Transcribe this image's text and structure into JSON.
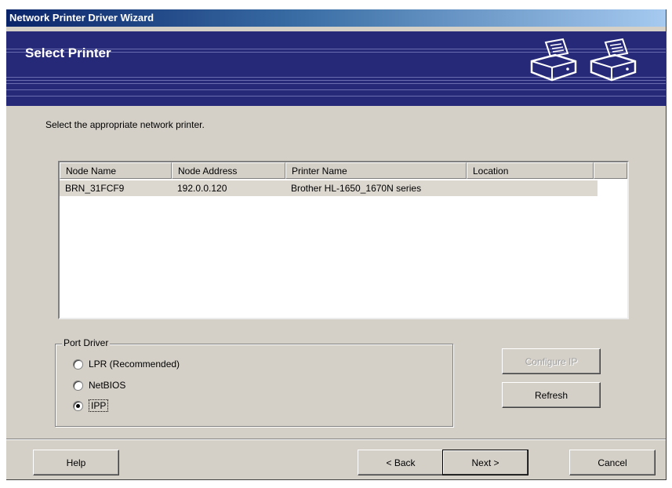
{
  "window": {
    "title": "Network Printer Driver Wizard"
  },
  "banner": {
    "title": "Select Printer"
  },
  "instruction": "Select the appropriate network printer.",
  "printer_list": {
    "columns": [
      "Node Name",
      "Node Address",
      "Printer Name",
      "Location"
    ],
    "rows": [
      {
        "node_name": "BRN_31FCF9",
        "node_address": "192.0.0.120",
        "printer_name": "Brother HL-1650_1670N series",
        "location": ""
      }
    ]
  },
  "port_driver": {
    "label": "Port Driver",
    "options": [
      {
        "label": "LPR (Recommended)",
        "selected": false
      },
      {
        "label": "NetBIOS",
        "selected": false
      },
      {
        "label": "IPP",
        "selected": true
      }
    ]
  },
  "buttons": {
    "configure_ip": "Configure IP",
    "refresh": "Refresh",
    "help": "Help",
    "back": "< Back",
    "next": "Next >",
    "cancel": "Cancel"
  }
}
